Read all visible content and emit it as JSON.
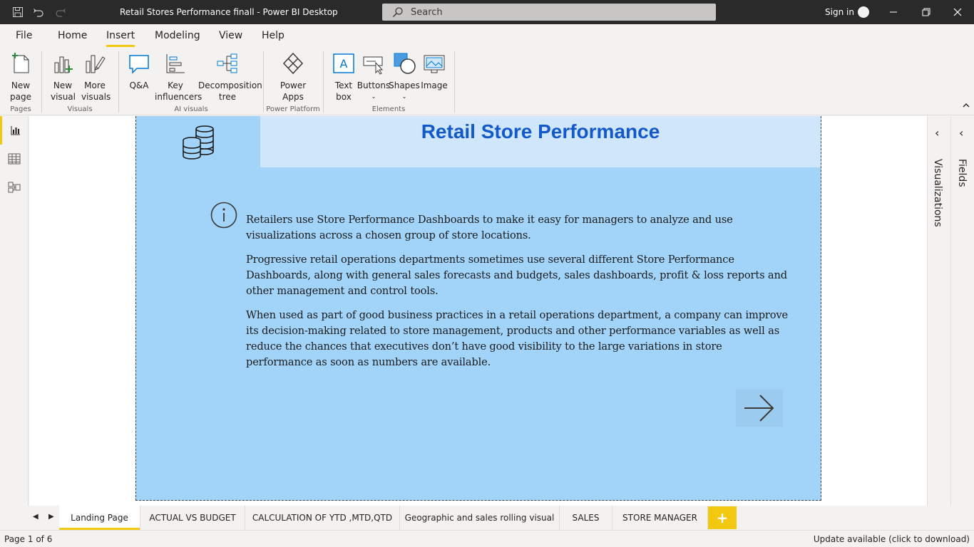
{
  "titlebar": {
    "title": "Retail Stores Performance finall - Power BI Desktop",
    "search_placeholder": "Search",
    "sign_in": "Sign in"
  },
  "ribbon_tabs": [
    "File",
    "Home",
    "Insert",
    "Modeling",
    "View",
    "Help"
  ],
  "ribbon": {
    "new_page": "New page",
    "new_visual": "New visual",
    "more_visuals": "More visuals",
    "qa": "Q&A",
    "key_influencers": "Key influencers",
    "decomposition_tree": "Decomposition tree",
    "power_apps": "Power Apps",
    "text_box": "Text box",
    "buttons": "Buttons",
    "shapes": "Shapes",
    "image": "Image",
    "group_pages": "Pages",
    "group_visuals": "Visuals",
    "group_ai": "AI visuals",
    "group_power_platform": "Power Platform",
    "group_elements": "Elements"
  },
  "report": {
    "title": "Retail Store  Performance",
    "paragraphs": [
      "Retailers use Store Performance Dashboards to make it easy for managers to analyze and use visualizations across a chosen group of store locations.",
      "Progressive retail operations departments sometimes use several different Store Performance Dashboards, along with general sales forecasts and budgets, sales dashboards, profit & loss reports and other management and control tools.",
      "When used as part of good business practices in a retail operations department, a company can improve its decision-making related to store management, products and other performance variables as well as reduce the chances that executives don’t have good visibility to the large variations in store performance as soon as numbers are available."
    ]
  },
  "panes": {
    "visualizations": "Visualizations",
    "fields": "Fields"
  },
  "page_tabs": [
    "Landing Page",
    "ACTUAL VS BUDGET",
    "CALCULATION OF YTD ,MTD,QTD",
    "Geographic and sales rolling visual",
    "SALES",
    "STORE MANAGER"
  ],
  "add_page": "+",
  "status": {
    "page_indicator": "Page 1 of 6",
    "update": "Update available (click to download)"
  },
  "colors": {
    "accent": "#f2c811",
    "report_bg": "#a2d3f8",
    "header_bg": "#cfe6fb",
    "title": "#1359c9"
  }
}
